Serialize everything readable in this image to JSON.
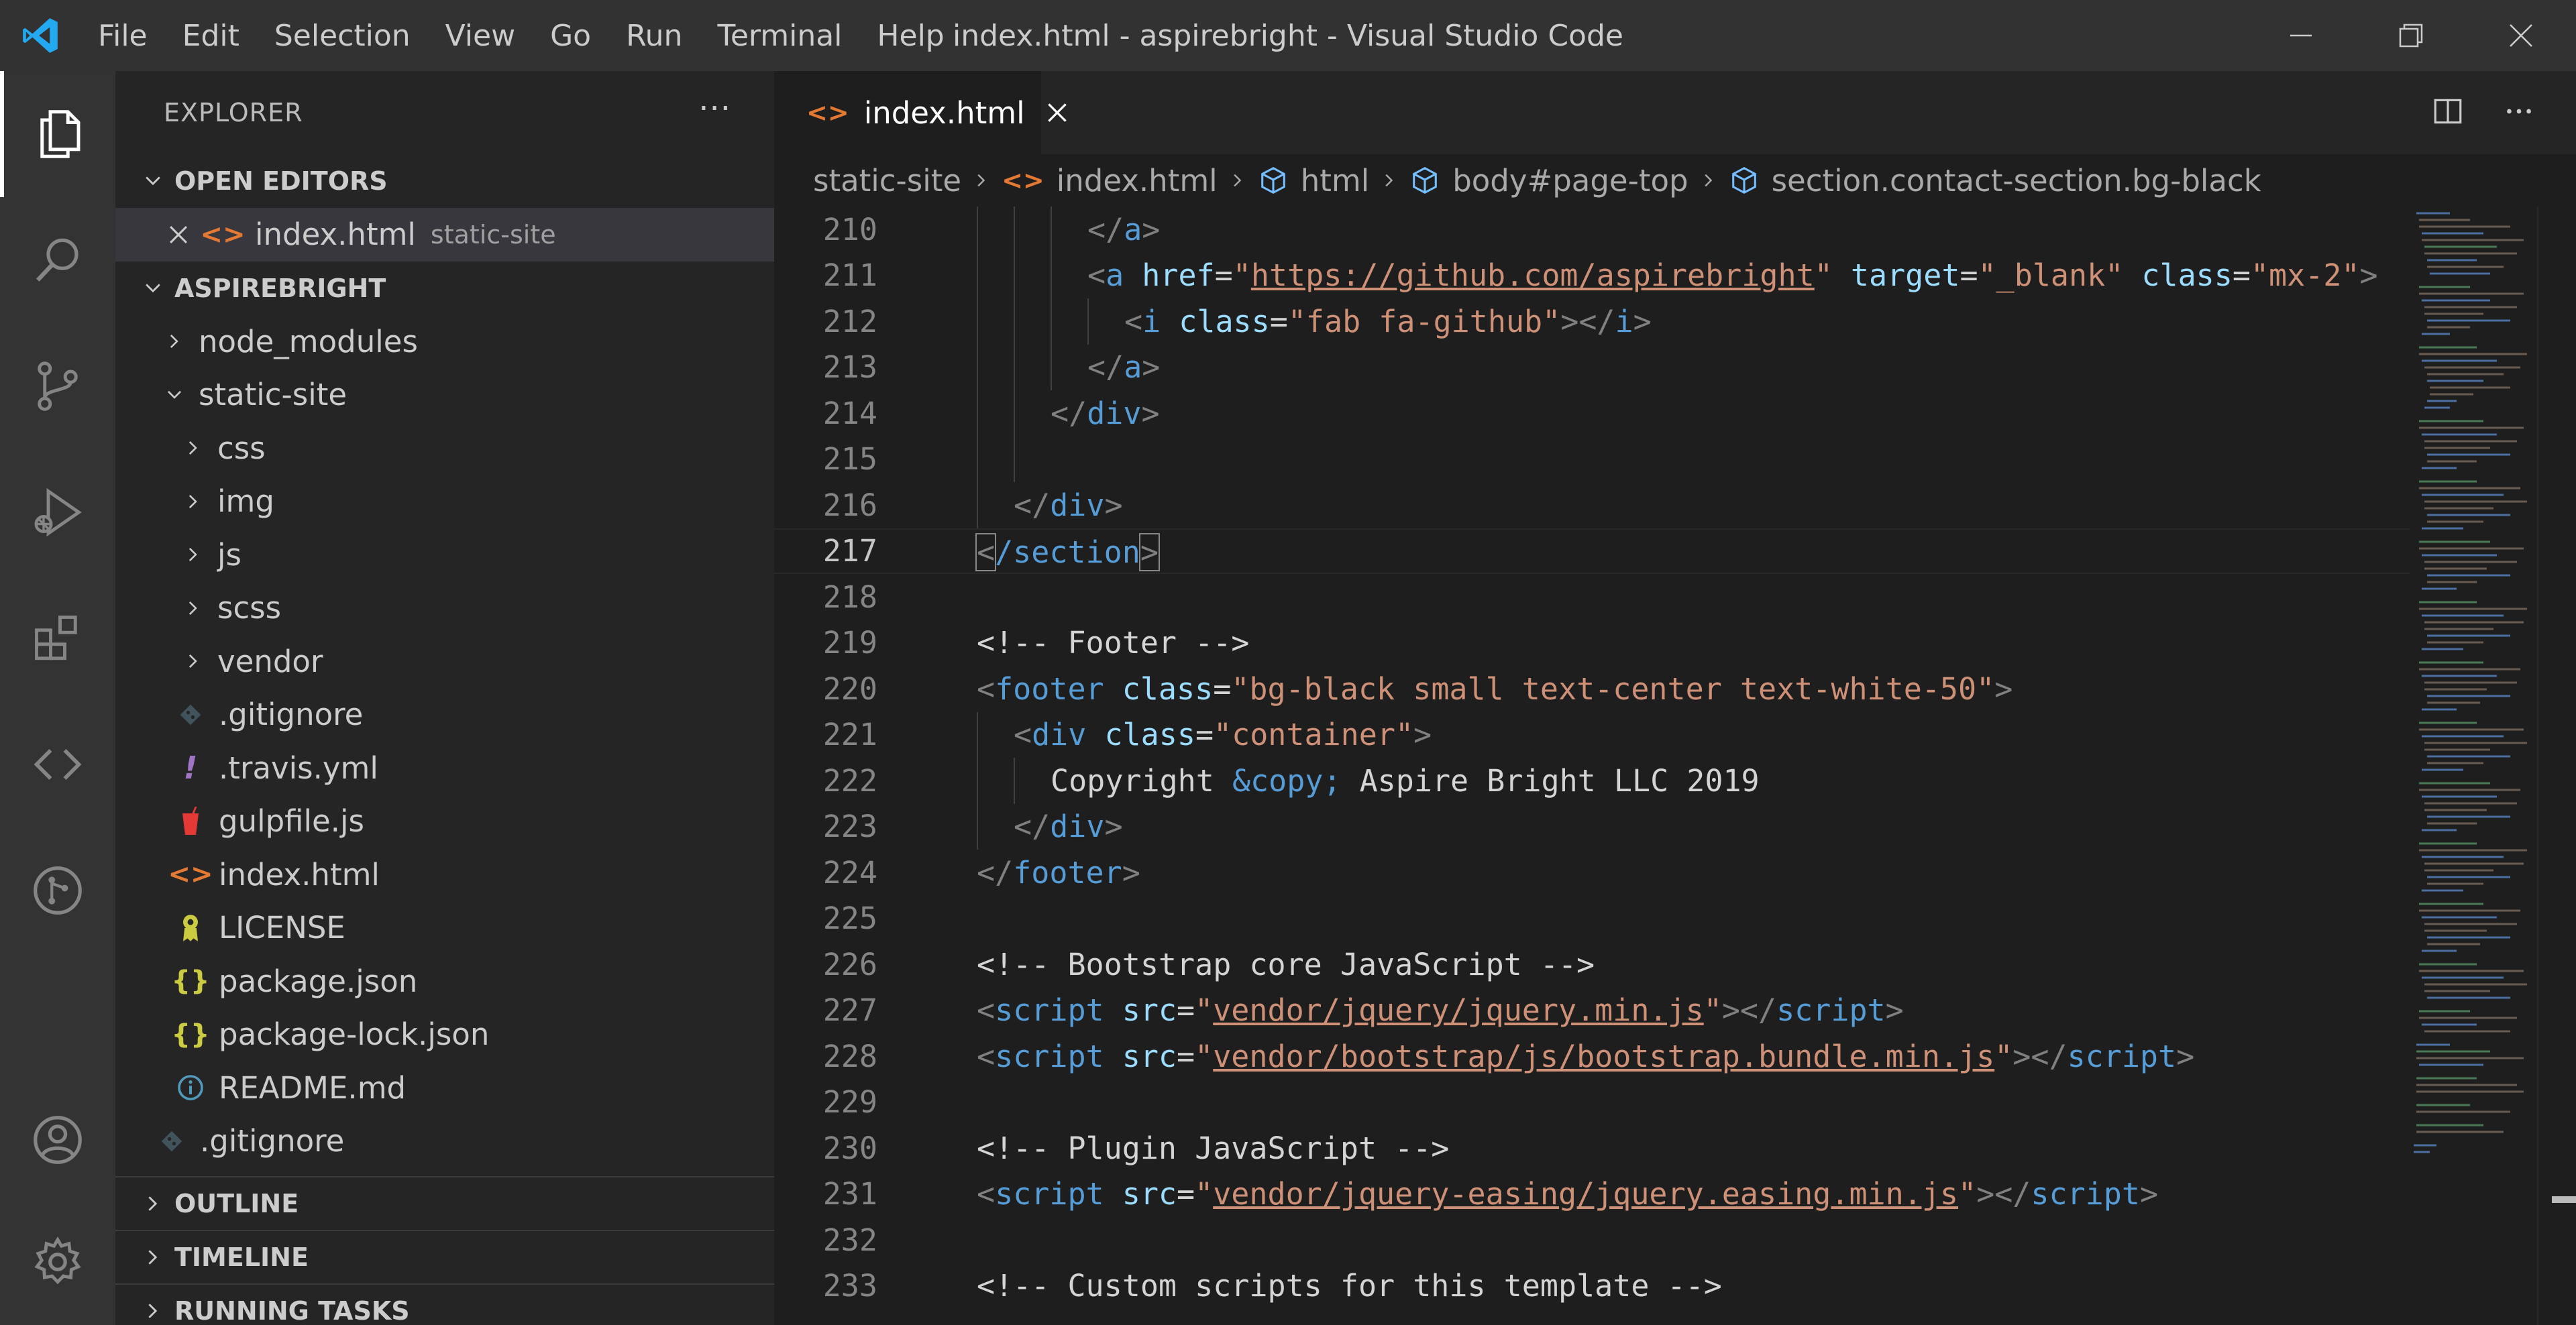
{
  "window": {
    "title": "index.html - aspirebright - Visual Studio Code",
    "menu": [
      "File",
      "Edit",
      "Selection",
      "View",
      "Go",
      "Run",
      "Terminal",
      "Help"
    ]
  },
  "activity_bar": {
    "items": [
      "explorer-icon",
      "search-icon",
      "source-control-icon",
      "run-debug-icon",
      "extensions-icon",
      "remote-explorer-icon",
      "git-graph-icon"
    ],
    "bottom_items": [
      "accounts-icon",
      "manage-gear-icon"
    ]
  },
  "sidebar": {
    "title": "EXPLORER",
    "more": "···",
    "open_editors": {
      "label": "OPEN EDITORS",
      "items": [
        {
          "name": "index.html",
          "description": "static-site"
        }
      ]
    },
    "root": {
      "label": "ASPIREBRIGHT",
      "items": [
        {
          "name": "node_modules"
        },
        {
          "name": "static-site"
        },
        {
          "name": "css"
        },
        {
          "name": "img"
        },
        {
          "name": "js"
        },
        {
          "name": "scss"
        },
        {
          "name": "vendor"
        },
        {
          "name": ".gitignore",
          "icon": "git-icon"
        },
        {
          "name": ".travis.yml",
          "icon": "!"
        },
        {
          "name": "gulpfile.js",
          "icon": "gulp-icon"
        },
        {
          "name": "index.html",
          "icon": "<>"
        },
        {
          "name": "LICENSE",
          "icon": "license-icon"
        },
        {
          "name": "package.json",
          "icon": "{}"
        },
        {
          "name": "package-lock.json",
          "icon": "{}"
        },
        {
          "name": "README.md",
          "icon": "info-icon"
        },
        {
          "name": ".gitignore",
          "icon": "git-icon"
        }
      ]
    },
    "outline": "OUTLINE",
    "timeline": "TIMELINE",
    "running_tasks": "RUNNING TASKS"
  },
  "editor": {
    "tab": {
      "name": "index.html",
      "icon": "<>"
    },
    "breadcrumb": [
      "static-site",
      "index.html",
      "html",
      "body#page-top",
      "section.contact-section.bg-black"
    ],
    "lines": [
      {
        "n": "210",
        "t1": "</",
        "t2": "a",
        "t3": ">"
      },
      {
        "n": "211",
        "a1": "<",
        "a2": "a",
        "a3": " ",
        "a4": "href",
        "a5": "=",
        "a6": "\"",
        "a7": "https://github.com/aspirebright",
        "a8": "\"",
        "a9": " ",
        "a10": "target",
        "a11": "=",
        "a12": "\"_blank\"",
        "a13": " ",
        "a14": "class",
        "a15": "=",
        "a16": "\"mx-2\"",
        "a17": ">"
      },
      {
        "n": "212",
        "a1": "<",
        "a2": "i",
        "a3": " ",
        "a4": "class",
        "a5": "=",
        "a6": "\"fab fa-github\"",
        "a7": "></",
        "a8": "i",
        "a9": ">"
      },
      {
        "n": "213",
        "t1": "</",
        "t2": "a",
        "t3": ">"
      },
      {
        "n": "214",
        "t1": "</",
        "t2": "div",
        "t3": ">"
      },
      {
        "n": "215"
      },
      {
        "n": "216",
        "t1": "</",
        "t2": "div",
        "t3": ">"
      },
      {
        "n": "217",
        "t1": "<",
        "t2": "/section",
        "t3": ">"
      },
      {
        "n": "218"
      },
      {
        "n": "219",
        "c": "<!-- Footer -->"
      },
      {
        "n": "220",
        "a1": "<",
        "a2": "footer",
        "a3": " ",
        "a4": "class",
        "a5": "=",
        "a6": "\"bg-black small text-center text-white-50\"",
        "a7": ">"
      },
      {
        "n": "221",
        "a1": "<",
        "a2": "div",
        "a3": " ",
        "a4": "class",
        "a5": "=",
        "a6": "\"container\"",
        "a7": ">"
      },
      {
        "n": "222",
        "x1": "Copyright ",
        "x2": "&copy;",
        "x3": " Aspire Bright LLC 2019"
      },
      {
        "n": "223",
        "t1": "</",
        "t2": "div",
        "t3": ">"
      },
      {
        "n": "224",
        "t1": "</",
        "t2": "footer",
        "t3": ">"
      },
      {
        "n": "225"
      },
      {
        "n": "226",
        "c": "<!-- Bootstrap core JavaScript -->"
      },
      {
        "n": "227",
        "a1": "<",
        "a2": "script",
        "a3": " ",
        "a4": "src",
        "a5": "=",
        "a6": "\"",
        "a7": "vendor/jquery/jquery.min.js",
        "a8": "\"",
        "a9": "></",
        "a10": "script",
        "a11": ">"
      },
      {
        "n": "228",
        "a1": "<",
        "a2": "script",
        "a3": " ",
        "a4": "src",
        "a5": "=",
        "a6": "\"",
        "a7": "vendor/bootstrap/js/bootstrap.bundle.min.js",
        "a8": "\"",
        "a9": "></",
        "a10": "script",
        "a11": ">"
      },
      {
        "n": "229"
      },
      {
        "n": "230",
        "c": "<!-- Plugin JavaScript -->"
      },
      {
        "n": "231",
        "a1": "<",
        "a2": "script",
        "a3": " ",
        "a4": "src",
        "a5": "=",
        "a6": "\"",
        "a7": "vendor/jquery-easing/jquery.easing.min.js",
        "a8": "\"",
        "a9": "></",
        "a10": "script",
        "a11": ">"
      },
      {
        "n": "232"
      },
      {
        "n": "233",
        "c": "<!-- Custom scripts for this template -->"
      }
    ]
  }
}
